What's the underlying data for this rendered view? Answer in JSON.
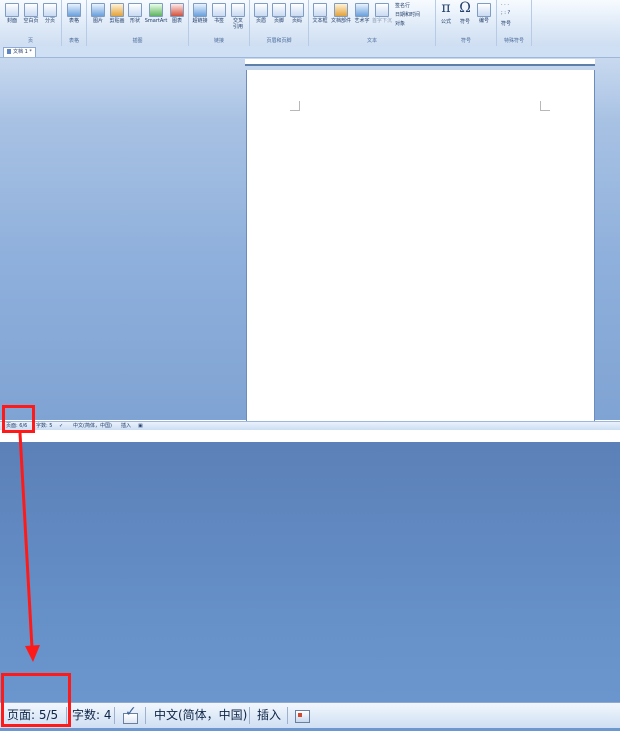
{
  "ribbon": {
    "groups": [
      {
        "label": "页",
        "buttons": [
          "封面",
          "空白页",
          "分页"
        ]
      },
      {
        "label": "表格",
        "buttons": [
          "表格"
        ]
      },
      {
        "label": "插图",
        "buttons": [
          "图片",
          "剪贴画",
          "形状",
          "SmartArt",
          "图表"
        ]
      },
      {
        "label": "链接",
        "buttons": [
          "超链接",
          "书签",
          "交叉\n引用"
        ]
      },
      {
        "label": "页眉和页脚",
        "buttons": [
          "页眉",
          "页脚",
          "页码"
        ]
      },
      {
        "label": "文本",
        "buttons": [
          "文本框",
          "文档部件",
          "艺术字",
          "首字下沉"
        ],
        "small_items": [
          "签名行",
          "日期和时间",
          "对象"
        ]
      },
      {
        "label": "符号",
        "buttons": [
          "公式",
          "符号",
          "编号"
        ]
      },
      {
        "label": "特殊符号",
        "buttons": [
          "符号"
        ]
      }
    ]
  },
  "document_tab": "文档 1 *",
  "status_small": {
    "page": "页面: 6/6",
    "words": "字数: 5",
    "language": "中文(简体，中国)",
    "mode": "插入"
  },
  "status_zoom": {
    "page": "页面: 5/5",
    "words": "字数: 4",
    "language": "中文(简体，中国)",
    "mode": "插入"
  },
  "colors": {
    "annotation": "#ff1a1a",
    "workspace": "#8fb0dc",
    "zoom_background": "#6690c8"
  }
}
